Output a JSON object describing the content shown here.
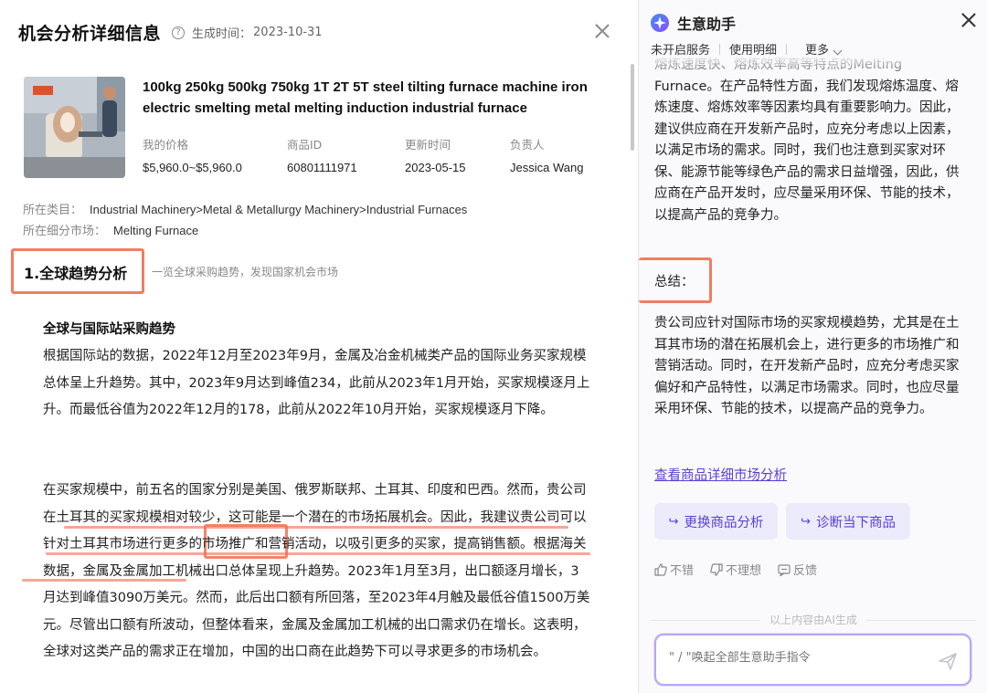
{
  "left": {
    "title": "机会分析详细信息",
    "gen_time_label": "生成时间：",
    "gen_time_value": "2023-10-31",
    "product": {
      "title": "100kg 250kg 500kg 750kg 1T 2T 5T steel tilting furnace machine iron electric smelting metal melting induction industrial furnace",
      "meta": [
        {
          "label": "我的价格",
          "value": "$5,960.0~$5,960.0"
        },
        {
          "label": "商品ID",
          "value": "60801111971"
        },
        {
          "label": "更新时间",
          "value": "2023-05-15"
        },
        {
          "label": "负责人",
          "value": "Jessica Wang"
        }
      ]
    },
    "category_label": "所在类目：",
    "category_value": "Industrial Machinery>Metal & Metallurgy Machinery>Industrial Furnaces",
    "market_label": "所在细分市场：",
    "market_value": "Melting Furnace",
    "section_title": "1.全球趋势分析",
    "section_subtitle": "一览全球采购趋势，发现国家机会市场",
    "subhead": "全球与国际站采购趋势",
    "para1": "根据国际站的数据，2022年12月至2023年9月，金属及冶金机械类产品的国际业务买家规模总体呈上升趋势。其中，2023年9月达到峰值234，此前从2023年1月开始，买家规模逐月上升。而最低谷值为2022年12月的178，此前从2022年10月开始，买家规模逐月下降。",
    "para2": "在买家规模中，前五名的国家分别是美国、俄罗斯联邦、土耳其、印度和巴西。然而，贵公司在土耳其的买家规模相对较少，这可能是一个潜在的市场拓展机会。因此，我建议贵公司可以针对土耳其市场进行更多的市场推广和营销活动，以吸引更多的买家，提高销售额。根据海关数据，金属及金属加工机械出口总体呈现上升趋势。2023年1月至3月，出口额逐月增长，3月达到峰值3090万美元。然而，此后出口额有所回落，至2023年4月触及最低谷值1500万美元。尽管出口额有所波动，但整体看来，金属及金属加工机械的出口需求仍在增长。这表明，全球对这类产品的需求正在增加，中国的出口商在此趋势下可以寻求更多的市场机会。"
  },
  "assistant": {
    "name": "生意助手",
    "nav": [
      "未开启服务",
      "使用明细",
      "更多"
    ],
    "para_top": "熔炼速度快、熔炼效率高等特点的Melting Furnace。在产品特性方面，我们发现熔炼温度、熔炼速度、熔炼效率等因素均具有重要影响力。因此，建议供应商在开发新产品时，应充分考虑以上因素，以满足市场的需求。同时，我们也注意到买家对环保、能源节能等绿色产品的需求日益增强，因此，供应商在产品开发时，应尽量采用环保、节能的技术，以提高产品的竞争力。",
    "summary_label": "总结：",
    "summary": "贵公司应针对国际市场的买家规模趋势，尤其是在土耳其市场的潜在拓展机会上，进行更多的市场推广和营销活动。同时，在开发新产品时，应充分考虑买家偏好和产品特性，以满足市场需求。同时，也应尽量采用环保、节能的技术，以提高产品的竞争力。",
    "view_link": "查看商品详细市场分析",
    "btn_change": "更换商品分析",
    "btn_diagnose": "诊断当下商品",
    "fb_good": "不错",
    "fb_bad": "不理想",
    "fb_feedback": "反馈",
    "gen_note": "以上内容由AI生成",
    "cmd_placeholder": "\" / \"唤起全部生意助手指令"
  },
  "colors": {
    "accent": "#5a3fd6",
    "annotation": "#f07050"
  }
}
